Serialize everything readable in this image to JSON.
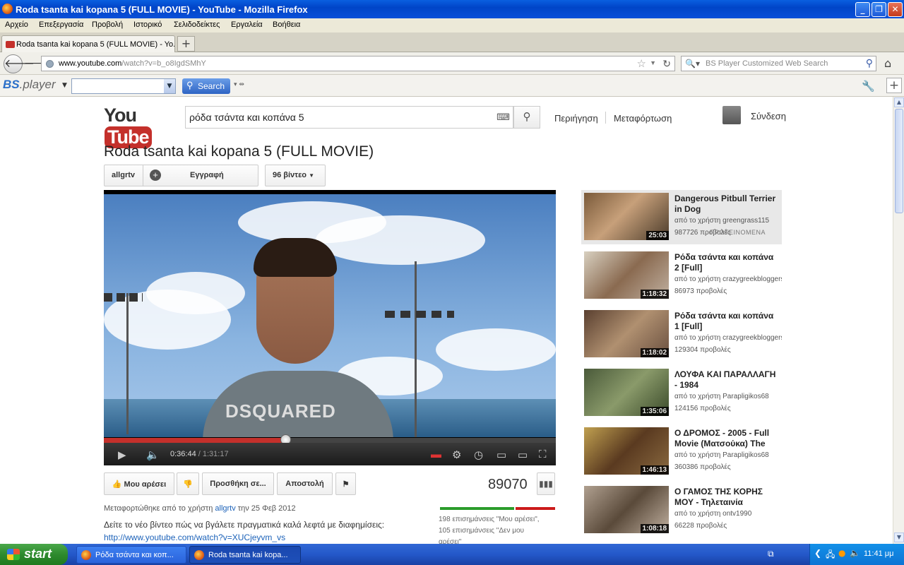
{
  "window": {
    "title": "Roda tsanta kai kopana 5 (FULL MOVIE) - YouTube - Mozilla Firefox",
    "minimize": "_",
    "maximize": "❐",
    "close": "✕"
  },
  "menu": [
    "Αρχείο",
    "Επεξεργασία",
    "Προβολή",
    "Ιστορικό",
    "Σελιδοδείκτες",
    "Εργαλεία",
    "Βοήθεια"
  ],
  "tab": {
    "label": "Roda tsanta kai kopana 5 (FULL MOVIE) - Yo...",
    "new_tab": "+"
  },
  "nav": {
    "url_domain": "www.youtube.com",
    "url_path": "/watch?v=b_o8IgdSMhY",
    "search_placeholder": "BS Player Customized Web Search"
  },
  "bs_toolbar": {
    "logo_a": "BS",
    "logo_b": ".player",
    "search_button": "Search"
  },
  "youtube": {
    "logo_you": "You",
    "logo_tube": "Tube",
    "search_value": "ρόδα τσάντα και κοπάνα 5",
    "browse": "Περιήγηση",
    "upload": "Μεταφόρτωση",
    "signin": "Σύνδεση"
  },
  "video": {
    "title": "Roda tsanta kai kopana 5 (FULL MOVIE)",
    "channel": "allgrtv",
    "subscribe": "Εγγραφή",
    "video_count": "96 βίντεο",
    "current_time": "0:36:44",
    "duration": "/ 1:31:17",
    "played_fraction": 0.402,
    "loaded_fraction": 0.41,
    "like": "Μου αρέσει",
    "add_to": "Προσθήκη σε...",
    "share": "Αποστολή",
    "views": "89070",
    "uploaded_prefix": "Μεταφορτώθηκε από το χρήστη ",
    "uploaded_user": "allgrtv",
    "uploaded_suffix": " την 25 Φεβ 2012",
    "description": "Δείτε το νέο βίντεο πώς να βγάλετε πραγματικά καλά λεφτά με διαφημίσεις:",
    "description_link": "http://www.youtube.com/watch?v=XUCjeyvm_vs",
    "likes_text": "198 επισημάνσεις \"Μου αρέσει\",",
    "dislikes_text": "105 επισημάνσεις \"Δεν μου",
    "dislikes_text_2": "αρέσει\"",
    "like_fraction": 0.653
  },
  "related": [
    {
      "title": "Dangerous Pitbull Terrier in Dog",
      "by": "από το χρήστη greengrass115",
      "views": "987726 προβολές",
      "featured": "ΠΡΟΤΕΙΝΟΜΕΝΑ",
      "duration": "25:03"
    },
    {
      "title": "Ρόδα τσάντα και κοπάνα 2 [Full]",
      "by": "από το χρήστη crazygreekbloggers",
      "views": "86973 προβολές",
      "duration": "1:18:32"
    },
    {
      "title": "Ρόδα τσάντα και κοπάνα 1 [Full]",
      "by": "από το χρήστη crazygreekbloggers",
      "views": "129304 προβολές",
      "duration": "1:18:02"
    },
    {
      "title": "ΛΟΥΦΑ ΚΑΙ ΠΑΡΑΛΛΑΓΗ - 1984",
      "by": "από το χρήστη Parapligikos68",
      "views": "124156 προβολές",
      "duration": "1:35:06"
    },
    {
      "title": "Ο ΔΡΟΜΟΣ - 2005 - Full Movie (Ματσούκα) The",
      "by": "από το χρήστη Parapligikos68",
      "views": "360386 προβολές",
      "duration": "1:46:13"
    },
    {
      "title": "Ο ΓΑΜΟΣ ΤΗΣ ΚΟΡΗΣ ΜΟΥ - Τηλεταινία",
      "by": "από το χρήστη ontv1990",
      "views": "66228 προβολές",
      "duration": "1:08:18"
    }
  ],
  "taskbar": {
    "start": "start",
    "task1": "Ρόδα τσάντα και κοπ...",
    "task2": "Roda tsanta kai kopa...",
    "clock": "11:41 μμ"
  },
  "colors": {
    "youtube_red": "#c4302b",
    "like_green": "#2b9c2b",
    "dislike_red": "#cc1b1b",
    "xp_blue": "#0045c8"
  }
}
